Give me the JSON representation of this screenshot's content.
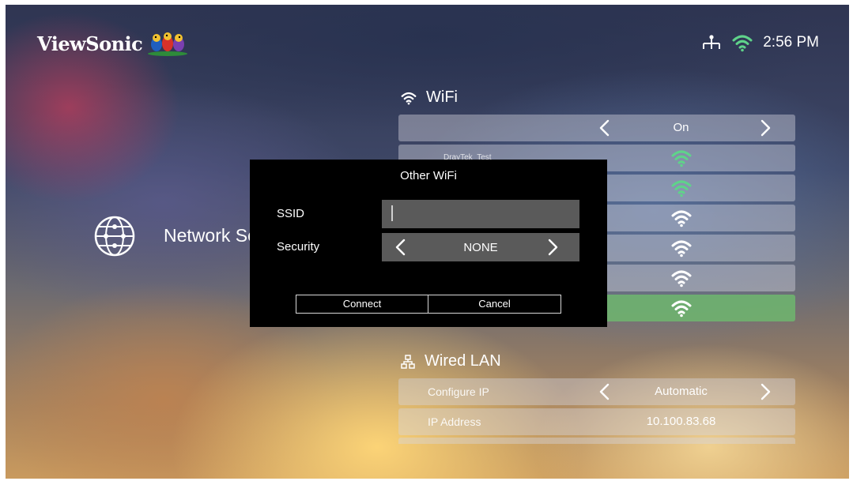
{
  "brand": {
    "name": "ViewSonic"
  },
  "status_bar": {
    "time": "2:56 PM",
    "icons": [
      "network-tree-icon",
      "wifi-icon"
    ]
  },
  "left_panel": {
    "title": "Network Settings",
    "icon": "globe-icon"
  },
  "wifi": {
    "header": "WiFi",
    "toggle_value": "On",
    "networks": [
      {
        "name": "DrayTek_Test",
        "signal": "strong"
      },
      {
        "name": "",
        "signal": "strong"
      },
      {
        "name": "",
        "signal": "medium"
      },
      {
        "name": "",
        "signal": "medium"
      },
      {
        "name": "",
        "signal": "medium"
      },
      {
        "name": "",
        "signal": "medium",
        "selected": true
      }
    ]
  },
  "wired_lan": {
    "header": "Wired LAN",
    "configure_ip_label": "Configure IP",
    "configure_ip_value": "Automatic",
    "ip_address_label": "IP Address",
    "ip_address_value": "10.100.83.68"
  },
  "dialog": {
    "title": "Other WiFi",
    "ssid_label": "SSID",
    "ssid_value": "",
    "security_label": "Security",
    "security_value": "NONE",
    "connect_label": "Connect",
    "cancel_label": "Cancel"
  },
  "colors": {
    "signal_green": "#5fd38a",
    "signal_white": "#ffffff",
    "selected_row": "#6eb96e",
    "dialog_bg": "#000000",
    "field_bg": "#5a5a5a"
  }
}
